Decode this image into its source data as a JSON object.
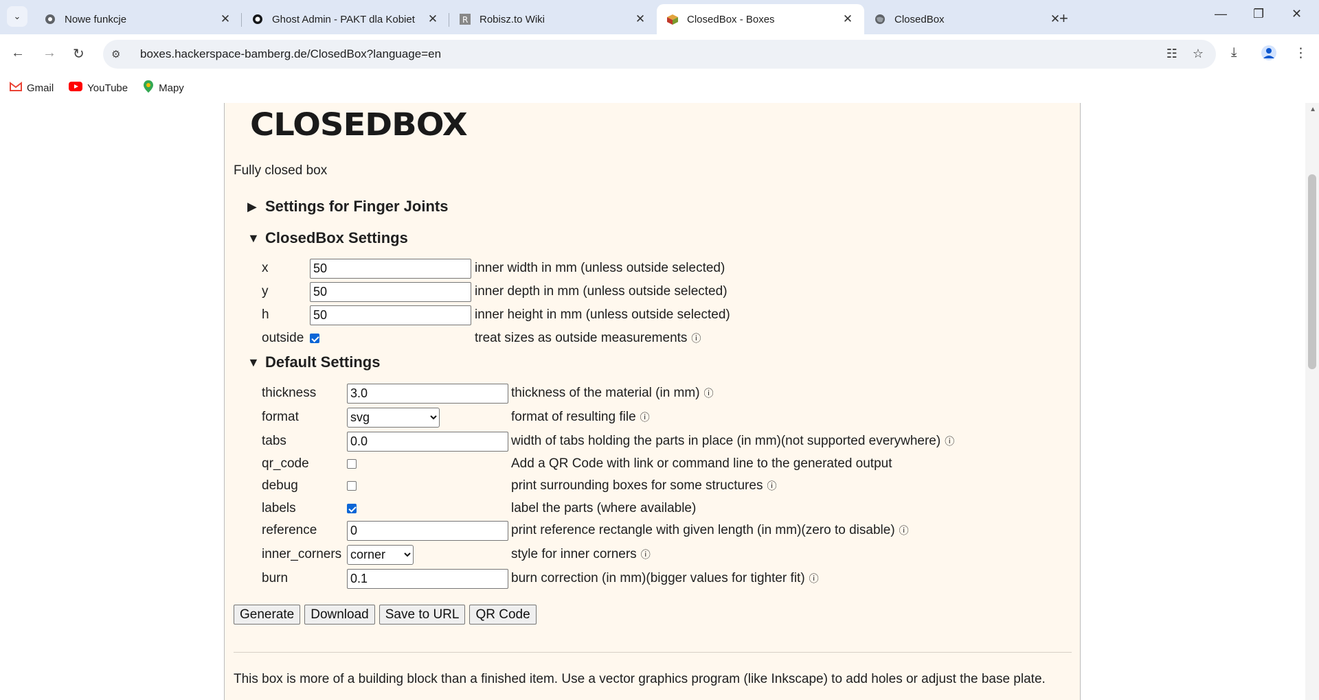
{
  "browser": {
    "tabs": [
      {
        "title": "Nowe funkcje",
        "icon": "chrome-icon"
      },
      {
        "title": "Ghost Admin - PAKT dla Kobiet",
        "icon": "ghost-icon"
      },
      {
        "title": "Robisz.to Wiki",
        "icon": "wiki-icon"
      },
      {
        "title": "ClosedBox - Boxes",
        "icon": "boxes-icon",
        "active": true
      },
      {
        "title": "ClosedBox",
        "icon": "globe-icon"
      }
    ],
    "url": "boxes.hackerspace-bamberg.de/ClosedBox?language=en",
    "bookmarks": [
      {
        "label": "Gmail",
        "icon": "gmail-icon"
      },
      {
        "label": "YouTube",
        "icon": "youtube-icon"
      },
      {
        "label": "Mapy",
        "icon": "maps-icon"
      }
    ]
  },
  "page": {
    "logo": "CLOSEDBOX",
    "description": "Fully closed box",
    "sections": {
      "finger": "Settings for Finger Joints",
      "closedbox": "ClosedBox Settings",
      "default": "Default Settings"
    },
    "closedbox": {
      "x": {
        "label": "x",
        "value": "50",
        "help": "inner width in mm (unless outside selected)"
      },
      "y": {
        "label": "y",
        "value": "50",
        "help": "inner depth in mm (unless outside selected)"
      },
      "h": {
        "label": "h",
        "value": "50",
        "help": "inner height in mm (unless outside selected)"
      },
      "outside": {
        "label": "outside",
        "checked": true,
        "help": "treat sizes as outside measurements"
      }
    },
    "defaults": {
      "thickness": {
        "label": "thickness",
        "value": "3.0",
        "help": "thickness of the material (in mm)"
      },
      "format": {
        "label": "format",
        "value": "svg",
        "help": "format of resulting file"
      },
      "tabs": {
        "label": "tabs",
        "value": "0.0",
        "help": "width of tabs holding the parts in place (in mm)(not supported everywhere)"
      },
      "qr_code": {
        "label": "qr_code",
        "checked": false,
        "help": "Add a QR Code with link or command line to the generated output"
      },
      "debug": {
        "label": "debug",
        "checked": false,
        "help": "print surrounding boxes for some structures"
      },
      "labels": {
        "label": "labels",
        "checked": true,
        "help": "label the parts (where available)"
      },
      "reference": {
        "label": "reference",
        "value": "0",
        "help": "print reference rectangle with given length (in mm)(zero to disable)"
      },
      "inner_corners": {
        "label": "inner_corners",
        "value": "corner",
        "help": "style for inner corners"
      },
      "burn": {
        "label": "burn",
        "value": "0.1",
        "help": "burn correction (in mm)(bigger values for tighter fit)"
      }
    },
    "buttons": {
      "generate": "Generate",
      "download": "Download",
      "save_url": "Save to URL",
      "qr": "QR Code"
    },
    "footer_text": "This box is more of a building block than a finished item. Use a vector graphics program (like Inkscape) to add holes or adjust the base plate."
  },
  "colors": {
    "page_bg": "#fff8ee",
    "tabstrip": "#dfe7f5",
    "checkbox_on": "#0b66d6"
  }
}
